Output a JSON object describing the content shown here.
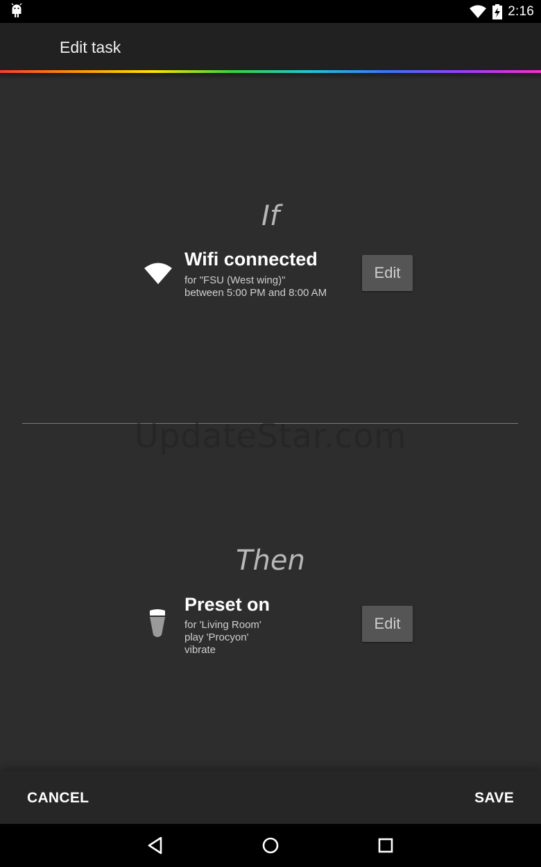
{
  "status_bar": {
    "time": "2:16",
    "icons": [
      "android-notification-icon",
      "wifi-signal-icon",
      "battery-charging-icon"
    ]
  },
  "app_bar": {
    "title": "Edit task"
  },
  "if_section": {
    "heading": "If",
    "icon": "wifi-icon",
    "title": "Wifi connected",
    "details": [
      "for \"FSU (West wing)\"",
      "between 5:00 PM and 8:00 AM"
    ],
    "edit_label": "Edit"
  },
  "then_section": {
    "heading": "Then",
    "icon": "light-bulb-icon",
    "title": "Preset on",
    "details": [
      "for 'Living Room'",
      "play 'Procyon'",
      "vibrate"
    ],
    "edit_label": "Edit"
  },
  "watermark": "UpdateStar.com",
  "actions": {
    "cancel_label": "CANCEL",
    "save_label": "SAVE"
  },
  "nav_bar": {
    "icons": [
      "back-icon",
      "home-icon",
      "recents-icon"
    ]
  },
  "colors": {
    "background": "#2d2d2d",
    "app_bar": "#212121",
    "edit_button": "#555555"
  }
}
